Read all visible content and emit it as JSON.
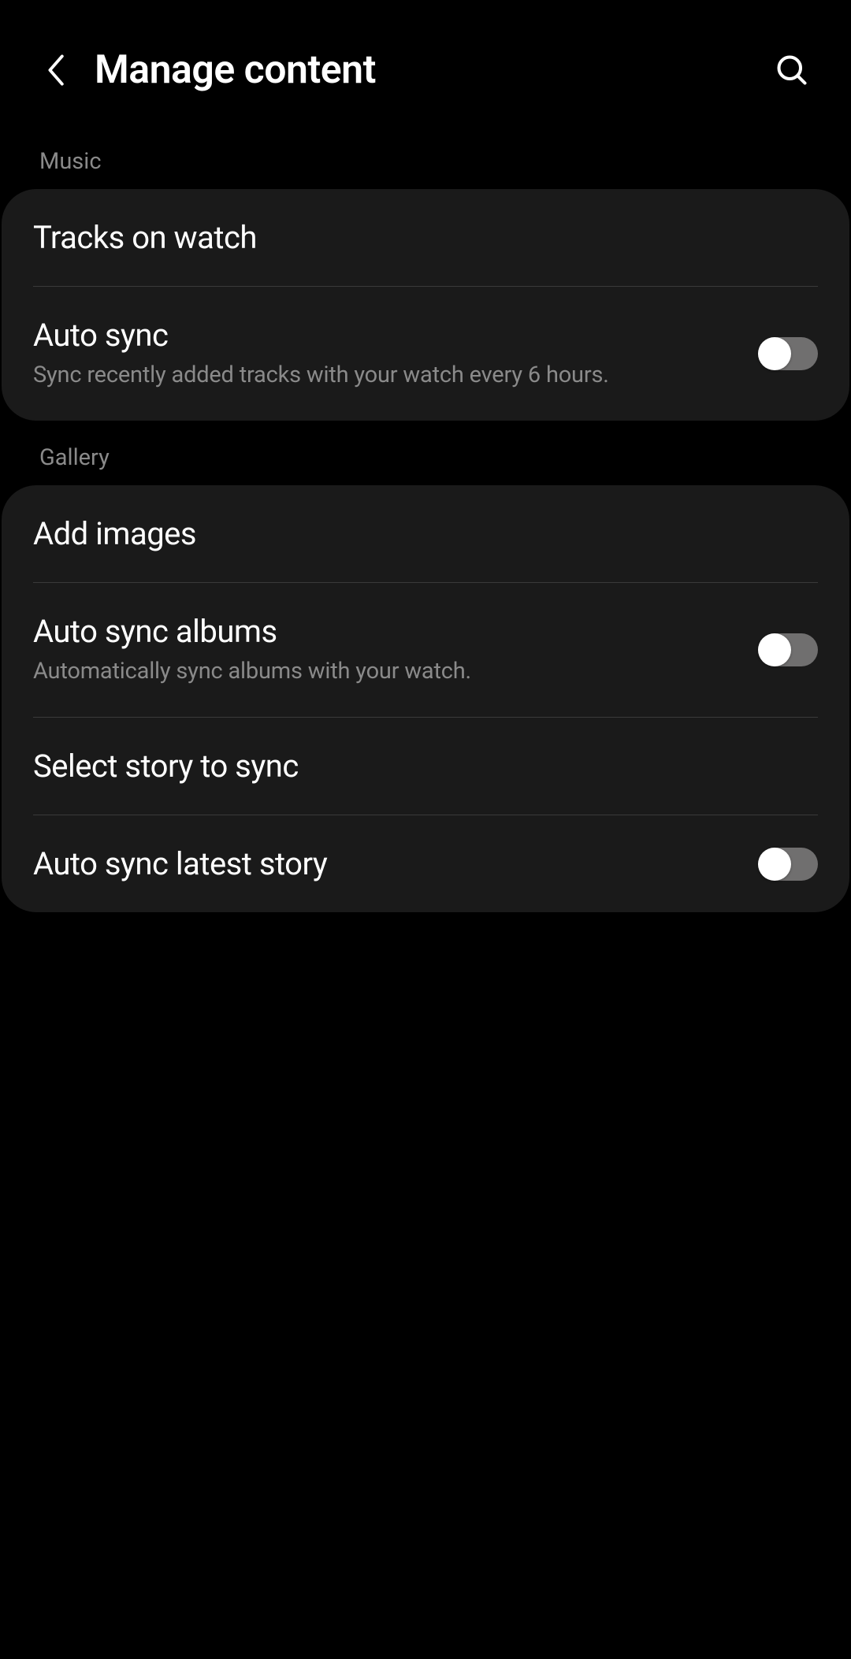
{
  "header": {
    "title": "Manage content"
  },
  "sections": {
    "music": {
      "label": "Music",
      "items": {
        "tracks": {
          "title": "Tracks on watch"
        },
        "autosync": {
          "title": "Auto sync",
          "subtitle": "Sync recently added tracks with your watch every 6 hours.",
          "toggle": false
        }
      }
    },
    "gallery": {
      "label": "Gallery",
      "items": {
        "add_images": {
          "title": "Add images"
        },
        "autosync_albums": {
          "title": "Auto sync albums",
          "subtitle": "Automatically sync albums with your watch.",
          "toggle": false
        },
        "select_story": {
          "title": "Select story to sync"
        },
        "autosync_story": {
          "title": "Auto sync latest story",
          "toggle": false
        }
      }
    }
  }
}
